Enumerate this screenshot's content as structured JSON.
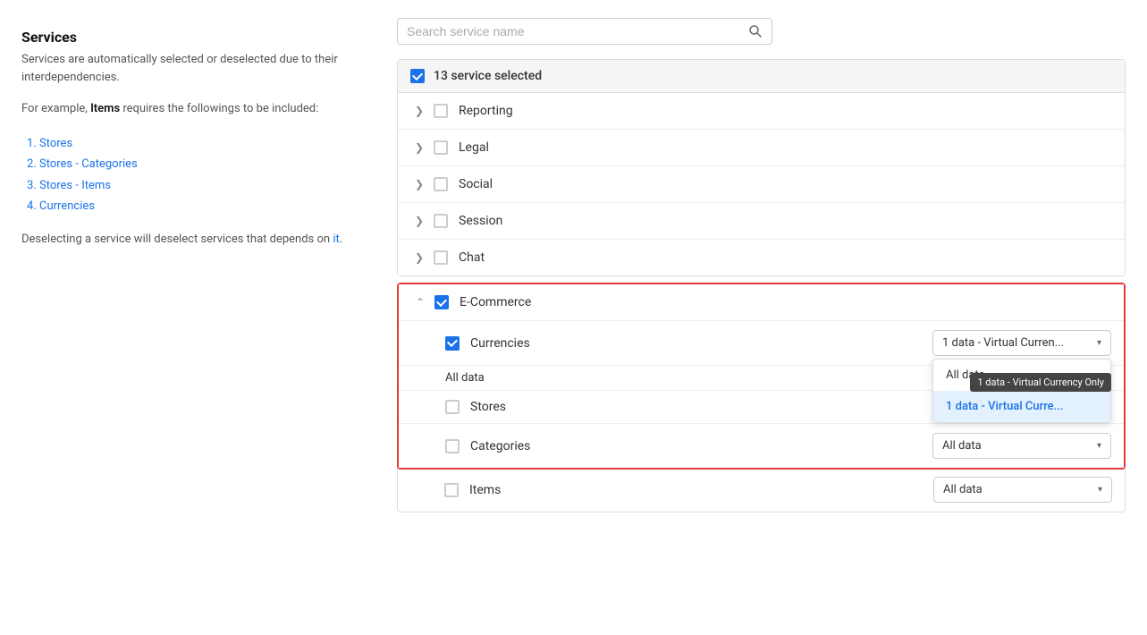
{
  "left": {
    "title": "Services",
    "subtitle": "Services are automatically selected or deselected due to their interdependencies.",
    "example_intro": "For example, ",
    "example_bold": "Items",
    "example_text": " requires the followings to be included:",
    "list_items": [
      "Stores",
      "Stores - Categories",
      "Stores - Items",
      "Currencies"
    ],
    "deselect_note_pre": "Deselecting a service will deselect services that depends on ",
    "deselect_note_link": "it",
    "deselect_note_post": "."
  },
  "search": {
    "placeholder": "Search service name"
  },
  "selected_header": {
    "label": "13 service selected"
  },
  "services": [
    {
      "name": "Reporting",
      "expanded": false,
      "checked": false
    },
    {
      "name": "Legal",
      "expanded": false,
      "checked": false
    },
    {
      "name": "Social",
      "expanded": false,
      "checked": false
    },
    {
      "name": "Session",
      "expanded": false,
      "checked": false
    },
    {
      "name": "Chat",
      "expanded": false,
      "checked": false
    }
  ],
  "ecommerce": {
    "name": "E-Commerce",
    "expanded": true,
    "checked": true,
    "sub_items": [
      {
        "name": "Currencies",
        "checked": true,
        "dropdown_value": "1 data - Virtual Curren...",
        "show_dropdown": true
      },
      {
        "name": "Stores",
        "checked": false,
        "dropdown_value": "All data",
        "show_dropdown": false
      },
      {
        "name": "Categories",
        "checked": false,
        "dropdown_value": "All data",
        "show_dropdown": false
      }
    ],
    "items_row": {
      "name": "Items",
      "checked": false,
      "dropdown_value": "All data"
    }
  },
  "dropdown_options": [
    {
      "label": "All data",
      "selected": false
    },
    {
      "label": "1 data - Virtual Curre...",
      "selected": true
    }
  ],
  "tooltip": {
    "text": "1 data - Virtual Currency Only"
  },
  "colors": {
    "blue": "#1a73e8",
    "red_border": "#e53935"
  }
}
